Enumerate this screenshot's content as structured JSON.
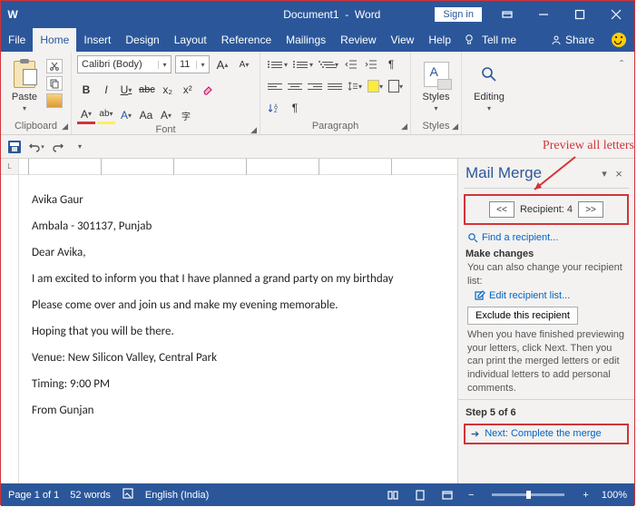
{
  "title": {
    "doc": "Document1",
    "app": "Word",
    "signin": "Sign in"
  },
  "menu": {
    "tabs": [
      "File",
      "Home",
      "Insert",
      "Design",
      "Layout",
      "Reference",
      "Mailings",
      "Review",
      "View",
      "Help"
    ],
    "active": "Home",
    "tellme": "Tell me",
    "share": "Share"
  },
  "ribbon": {
    "clipboard": {
      "paste": "Paste",
      "label": "Clipboard"
    },
    "font": {
      "family": "Calibri (Body)",
      "size": "11",
      "grow": "A",
      "shrink": "A",
      "clear_caret": "▾",
      "bold": "B",
      "italic": "I",
      "underline": "U",
      "strike": "abc",
      "sub": "x₂",
      "sup": "x²",
      "case": "Aa",
      "label": "Font"
    },
    "paragraph": {
      "label": "Paragraph"
    },
    "styles": {
      "btn": "Styles",
      "label": "Styles"
    },
    "editing": {
      "btn": "Editing"
    }
  },
  "doc": {
    "p1": "Avika Gaur",
    "p2": "Ambala - 301137, Punjab",
    "p3": "Dear Avika,",
    "p4": "I am excited to inform you that I have planned a grand party on my birthday",
    "p5": "Please come over and join us and make my evening memorable.",
    "p6": "Hoping that you will be there.",
    "p7": "Venue: New Silicon Valley, Central Park",
    "p8": "Timing: 9:00 PM",
    "p9": "From Gunjan"
  },
  "pane": {
    "title": "Mail Merge",
    "annotation": "Preview all letters",
    "prev": "<<",
    "recipient": "Recipient: 4",
    "next": ">>",
    "find": "Find a recipient...",
    "make_changes": "Make changes",
    "desc1": "You can also change your recipient list:",
    "edit": "Edit recipient list...",
    "exclude": "Exclude this recipient",
    "desc2": "When you have finished previewing your letters, click Next. Then you can print the merged letters or edit individual letters to add personal comments.",
    "step": "Step 5 of 6",
    "next_step": "Next: Complete the merge"
  },
  "status": {
    "page": "Page 1 of 1",
    "words": "52 words",
    "lang": "English (India)",
    "zoom": "100%"
  }
}
